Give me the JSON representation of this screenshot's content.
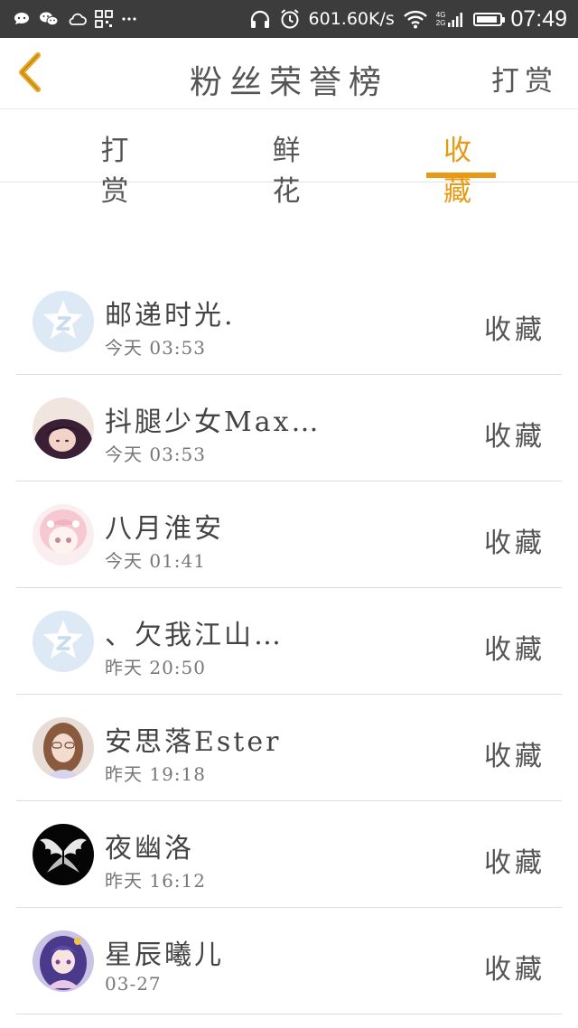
{
  "status_bar": {
    "network_speed": "601.60K/s",
    "network_types": [
      "4G",
      "2G"
    ],
    "time": "07:49",
    "battery_level": 0.9,
    "icons": [
      "chat-bubble-icon",
      "wechat-icon",
      "cloud-icon",
      "app-grid-icon",
      "more-dots-icon",
      "headphones-icon",
      "alarm-icon",
      "wifi-icon",
      "signal-icon",
      "battery-icon"
    ]
  },
  "nav": {
    "back_icon": "chevron-left-icon",
    "title": "粉丝荣誉榜",
    "right_action": "打赏"
  },
  "tabs": [
    {
      "label": "打赏",
      "active": false
    },
    {
      "label": "鲜花",
      "active": false
    },
    {
      "label": "收藏",
      "active": true
    }
  ],
  "colors": {
    "accent": "#e99a15",
    "status_bar": "#3c3c3c",
    "divider": "#dedede"
  },
  "fans": [
    {
      "name": "邮递时光.",
      "time": "今天 03:53",
      "action": "收藏",
      "avatar": "default-qzone-avatar"
    },
    {
      "name": "抖腿少女Max…",
      "time": "今天 03:53",
      "action": "收藏",
      "avatar": "dark-hair-girl-avatar"
    },
    {
      "name": "八月淮安",
      "time": "今天 01:41",
      "action": "收藏",
      "avatar": "anime-pink-girl-avatar"
    },
    {
      "name": "、欠我江山…",
      "time": "昨天 20:50",
      "action": "收藏",
      "avatar": "default-qzone-avatar"
    },
    {
      "name": "安思落Ester",
      "time": "昨天 19:18",
      "action": "收藏",
      "avatar": "photo-girl-avatar"
    },
    {
      "name": "夜幽洛",
      "time": "昨天 16:12",
      "action": "收藏",
      "avatar": "white-wings-avatar"
    },
    {
      "name": "星辰曦儿",
      "time": "03-27",
      "action": "收藏",
      "avatar": "anime-purple-girl-avatar"
    }
  ]
}
